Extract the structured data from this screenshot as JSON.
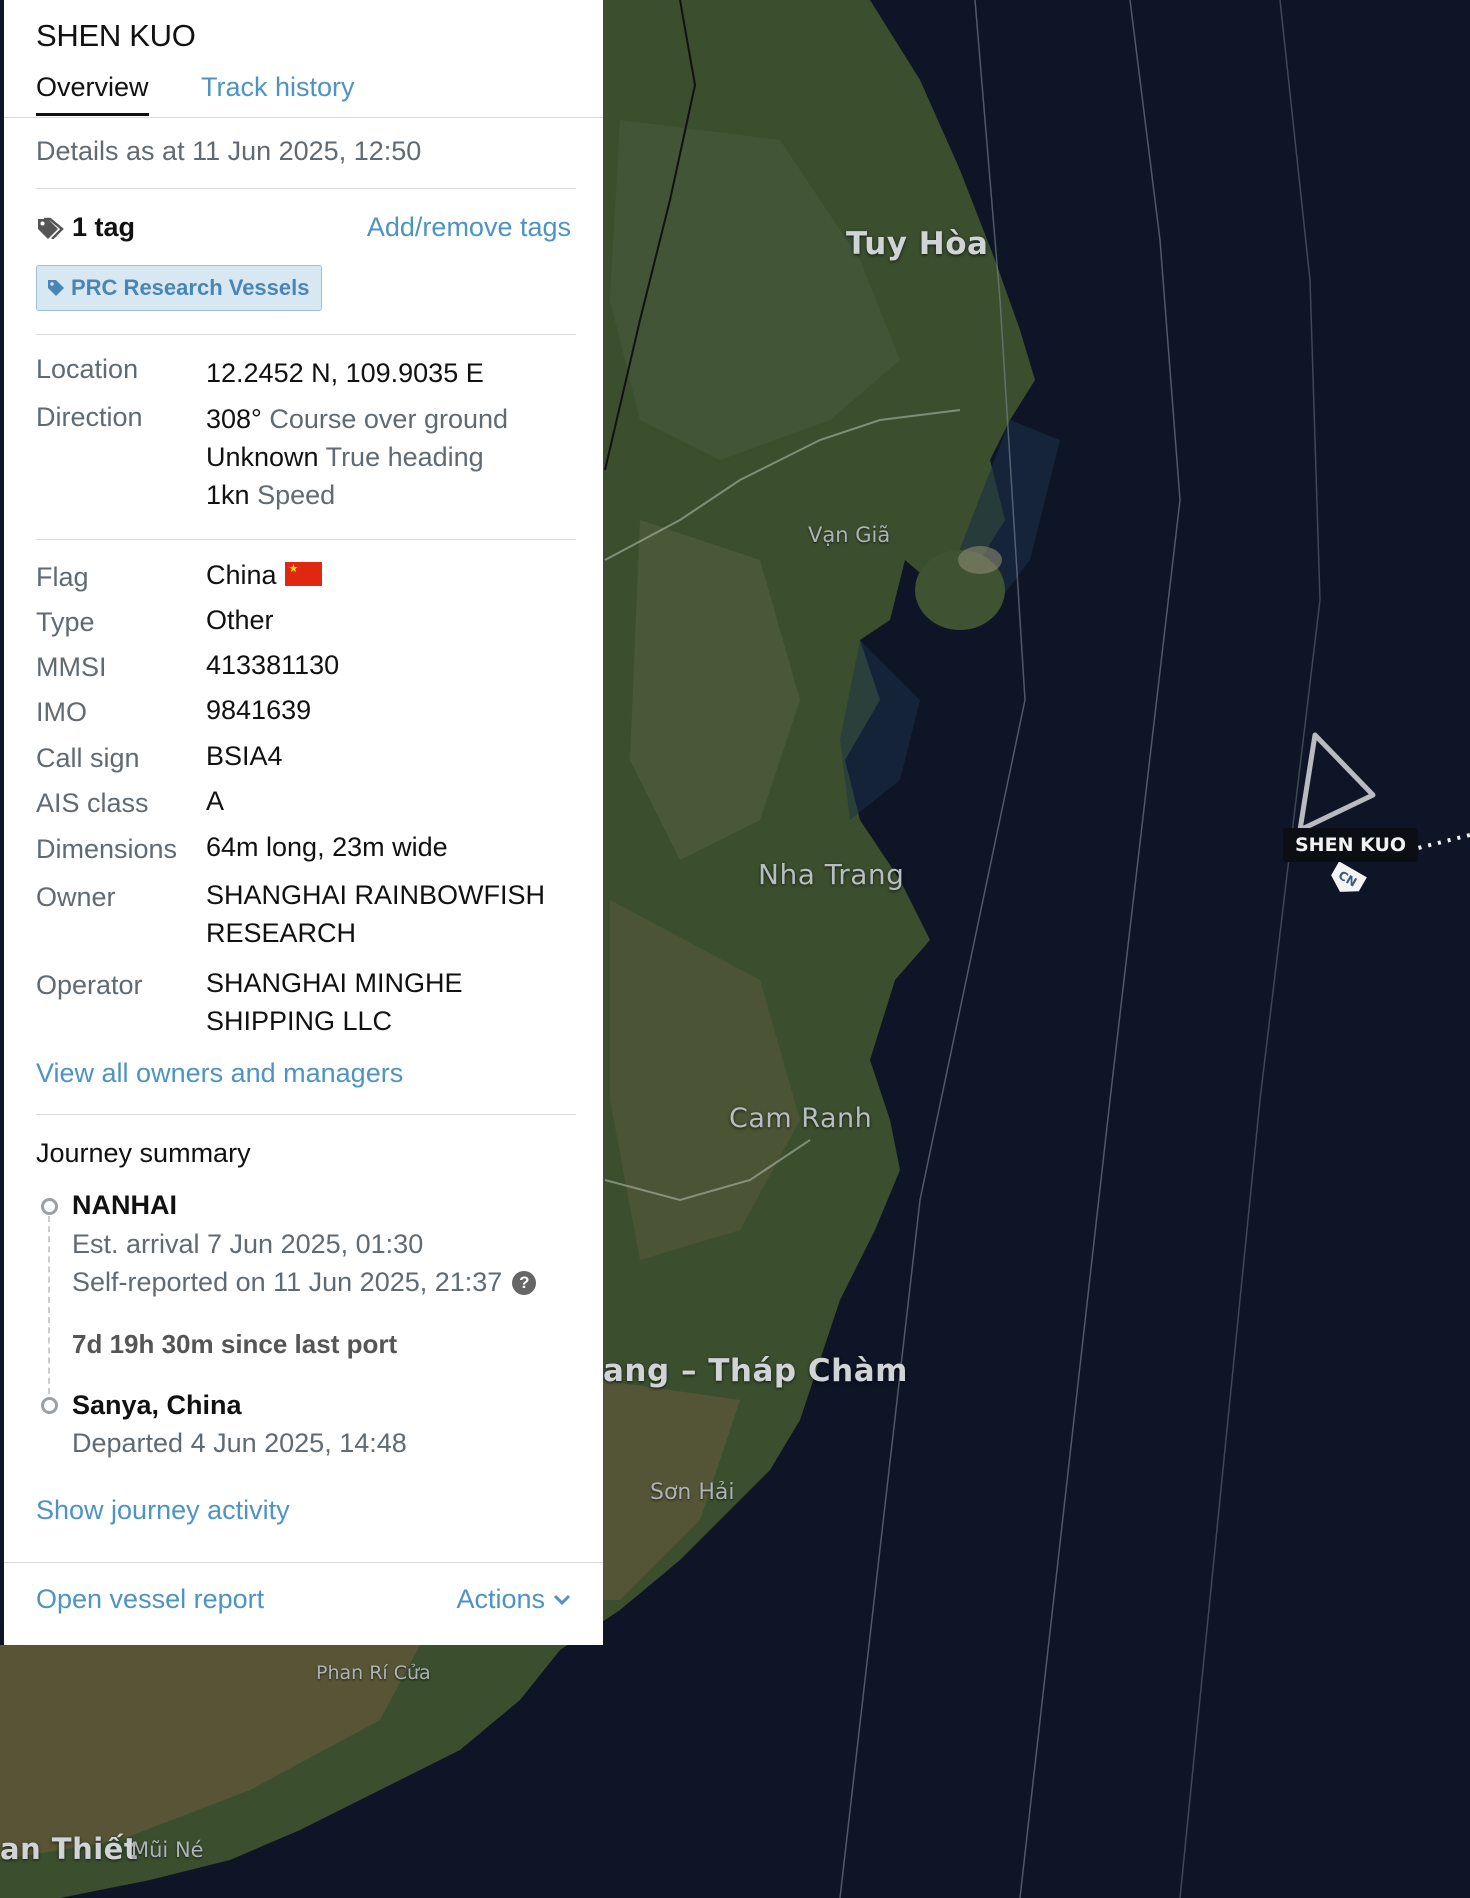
{
  "vessel": {
    "name": "SHEN KUO"
  },
  "tabs": [
    {
      "label": "Overview",
      "active": true
    },
    {
      "label": "Track history",
      "active": false
    }
  ],
  "details_as": "Details as at 11 Jun 2025, 12:50",
  "tags": {
    "count_label": "1 tag",
    "add_remove": "Add/remove tags",
    "chips": [
      "PRC Research Vessels"
    ]
  },
  "position": {
    "location_label": "Location",
    "location_value": "12.2452 N, 109.9035 E",
    "direction_label": "Direction",
    "course": "308°",
    "course_label": "Course over ground",
    "heading": "Unknown",
    "heading_label": "True heading",
    "speed": "1kn",
    "speed_label": "Speed"
  },
  "details": [
    {
      "label": "Flag",
      "value": "China"
    },
    {
      "label": "Type",
      "value": "Other"
    },
    {
      "label": "MMSI",
      "value": "413381130"
    },
    {
      "label": "IMO",
      "value": "9841639"
    },
    {
      "label": "Call sign",
      "value": "BSIA4"
    },
    {
      "label": "AIS class",
      "value": "A"
    },
    {
      "label": "Dimensions",
      "value": "64m long, 23m wide"
    }
  ],
  "owner": {
    "label": "Owner",
    "line1": "SHANGHAI RAINBOWFISH",
    "line2": "RESEARCH"
  },
  "operator": {
    "label": "Operator",
    "line1": "SHANGHAI MINGHE",
    "line2": "SHIPPING LLC"
  },
  "view_all_link": "View all owners and managers",
  "journey": {
    "title": "Journey summary",
    "destination": "NANHAI",
    "est_arrival": "Est. arrival 7 Jun 2025, 01:30",
    "self_reported": "Self-reported on 11 Jun 2025, 21:37",
    "since_last_port": "7d 19h 30m since last port",
    "origin": "Sanya, China",
    "departed": "Departed 4 Jun 2025, 14:48",
    "show_activity": "Show journey activity"
  },
  "footer": {
    "report": "Open vessel report",
    "actions": "Actions"
  },
  "map": {
    "labels": {
      "tuy_hoa": "Tuy Hòa",
      "van_gia": "Vạn Giã",
      "nha_trang": "Nha Trang",
      "cam_ranh": "Cam Ranh",
      "thap_cham": "ang – Tháp Chàm",
      "son_hai": "Sơn Hải",
      "phan_ri_cua": "Phan Rí Cửa",
      "phan_thiet": "an Thiết",
      "mui_ne": "Mũi Né"
    },
    "vessel_label": "SHEN KUO",
    "vessel_flag_icon": "CN",
    "colors": {
      "sea": "#0d1526",
      "land": "#3c5030",
      "panel_link": "#4d93c4"
    }
  }
}
